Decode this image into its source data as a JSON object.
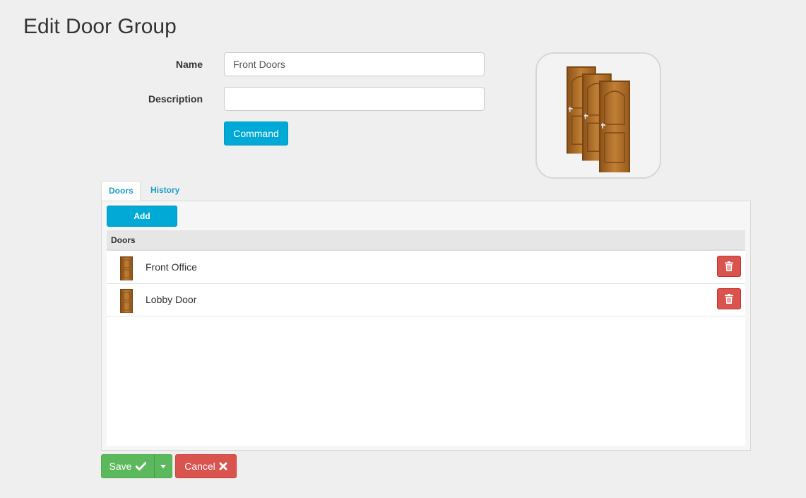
{
  "page": {
    "title": "Edit Door Group"
  },
  "form": {
    "name_label": "Name",
    "name_value": "Front Doors",
    "description_label": "Description",
    "description_value": "",
    "command_label": "Command"
  },
  "image": {
    "icon": "doors-group-image"
  },
  "tabs": [
    {
      "label": "Doors",
      "active": true
    },
    {
      "label": "History",
      "active": false
    }
  ],
  "doors_panel": {
    "add_label": "Add",
    "column_header": "Doors",
    "rows": [
      {
        "name": "Front Office",
        "icon": "door-icon"
      },
      {
        "name": "Lobby Door",
        "icon": "door-icon"
      }
    ]
  },
  "actions": {
    "save_label": "Save",
    "cancel_label": "Cancel"
  },
  "colors": {
    "info": "#00a9d6",
    "success": "#5cb85c",
    "danger": "#d9534f",
    "door_wood": "#b3702a"
  }
}
